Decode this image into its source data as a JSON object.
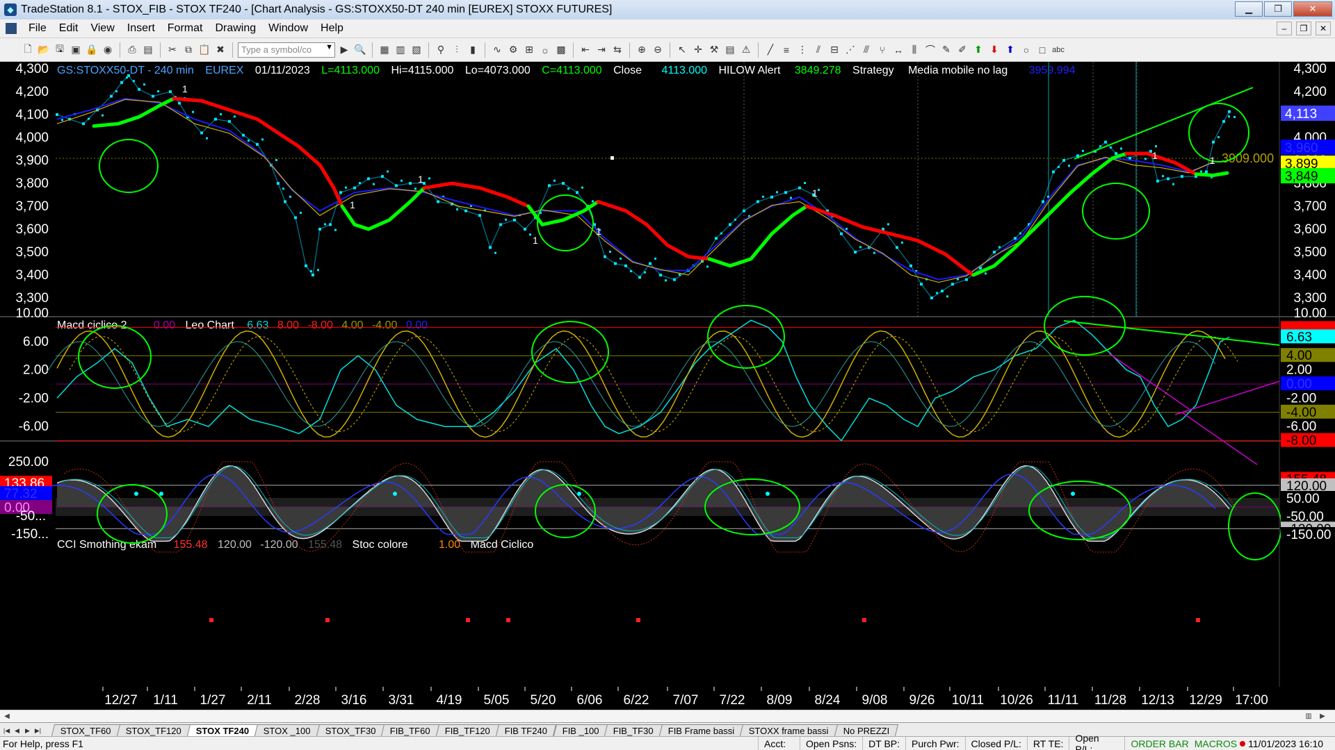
{
  "window": {
    "title": "TradeStation 8.1 - STOX_FIB - STOX TF240 - [Chart Analysis - GS:STOXX50-DT  240 min  [EUREX] STOXX FUTURES]"
  },
  "menu": [
    "File",
    "Edit",
    "View",
    "Insert",
    "Format",
    "Drawing",
    "Window",
    "Help"
  ],
  "toolbar": {
    "symbol_placeholder": "Type a symbol/co"
  },
  "price_panel": {
    "header": {
      "symbol": "GS:STOXX50-DT - 240 min",
      "exchange": "EUREX",
      "date": "01/11/2023",
      "last": "L=4113.000",
      "high": "Hi=4115.000",
      "low": "Lo=4073.000",
      "close_eq": "C=4113.000",
      "close_label": "Close",
      "close_val": "4113.000",
      "hilow_label": "HILOW Alert",
      "hilow_val": "3849.278",
      "strategy": "Strategy",
      "media_label": "Media mobile no lag",
      "media_val": "3959.994"
    },
    "y_ticks": [
      "4,300",
      "4,200",
      "4,100",
      "4,000",
      "3,900",
      "3,800",
      "3,700",
      "3,600",
      "3,500",
      "3,400",
      "3,300"
    ],
    "y_top_partial": "4,300",
    "price_label_level": "3909.000",
    "value_boxes": [
      {
        "text": "4,113",
        "bg": "#4040ff",
        "fg": "#ffffff"
      },
      {
        "text": "3,960",
        "bg": "#0000ff",
        "fg": "#3030ff"
      },
      {
        "text": "3,899",
        "bg": "#ffff00",
        "fg": "#000000"
      },
      {
        "text": "3,849",
        "bg": "#00ff00",
        "fg": "#000000"
      }
    ]
  },
  "macd_panel": {
    "header": {
      "name": "Macd ciclico 2",
      "v1": "0.00",
      "name2": "Leo Chart",
      "v2": "6.63",
      "v3": "8.00",
      "v4": "-8.00",
      "v5": "4.00",
      "v6": "-4.00",
      "v7": "0.00"
    },
    "y_ticks": [
      "10.00",
      "6.00",
      "2.00",
      "-2.00",
      "-6.00"
    ],
    "value_boxes": [
      {
        "text": "8.00",
        "bg": "#ff0000",
        "fg": "#ff0000"
      },
      {
        "text": "6.63",
        "bg": "#00ffff",
        "fg": "#000000"
      },
      {
        "text": "4.00",
        "bg": "#808000",
        "fg": "#000000"
      },
      {
        "text": "2.00",
        "bg": "#000000",
        "fg": "#ffffff"
      },
      {
        "text": "0.00",
        "bg": "#0000ff",
        "fg": "#3030ff"
      },
      {
        "text": "-2.00",
        "bg": "#000000",
        "fg": "#ffffff"
      },
      {
        "text": "-4.00",
        "bg": "#808000",
        "fg": "#000000"
      },
      {
        "text": "-6.00",
        "bg": "#000000",
        "fg": "#ffffff"
      },
      {
        "text": "-8.00",
        "bg": "#ff0000",
        "fg": "#000000"
      }
    ]
  },
  "cci_panel": {
    "header": {
      "name": "CCI Smothing ekam",
      "v1": "155.48",
      "v2": "120.00",
      "v3": "-120.00",
      "v4": "155.48",
      "name2": "Stoc colore",
      "v5": "1.00",
      "name3": "Macd Ciclico",
      "v6": "0.00"
    },
    "y_ticks": [
      "250.00",
      "50.00",
      "-50.00",
      "-150..."
    ],
    "right_boxes": [
      {
        "text": "155.48",
        "bg": "#ff0000",
        "fg": "#000000"
      },
      {
        "text": "120.00",
        "bg": "#c0c0c0",
        "fg": "#000000"
      },
      {
        "text": "50.00",
        "bg": "#000000",
        "fg": "#ffffff"
      },
      {
        "text": "-50.00",
        "bg": "#000000",
        "fg": "#ffffff"
      },
      {
        "text": "-120.00",
        "bg": "#c0c0c0",
        "fg": "#000000"
      },
      {
        "text": "-150.00",
        "bg": "#000000",
        "fg": "#ffffff"
      }
    ],
    "left_boxes": [
      {
        "text": "133.86",
        "bg": "#ff0000",
        "fg": "#ffffff"
      },
      {
        "text": "77.32",
        "bg": "#0000ff",
        "fg": "#3030ff"
      },
      {
        "text": "0.00",
        "bg": "#800080",
        "fg": "#ff80ff"
      }
    ]
  },
  "x_axis": [
    "12/27",
    "1/11",
    "1/27",
    "2/11",
    "2/28",
    "3/16",
    "3/31",
    "4/19",
    "5/05",
    "5/20",
    "6/06",
    "6/22",
    "7/07",
    "7/22",
    "8/09",
    "8/24",
    "9/08",
    "9/26",
    "10/11",
    "10/26",
    "11/11",
    "11/28",
    "12/13",
    "12/29",
    "17:00"
  ],
  "tabs": [
    "STOX_TF60",
    "STOX_TF120",
    "STOX TF240",
    "STOX _100",
    "STOX_TF30",
    "FIB_TF60",
    "FIB_TF120",
    "FIB TF240",
    "FIB _100",
    "FIB_TF30",
    "FIB Frame bassi",
    "STOXX frame bassi",
    "No PREZZI"
  ],
  "active_tab": "STOX TF240",
  "status": {
    "help": "For Help, press F1",
    "acct": "Acct:",
    "open_psns": "Open Psns:",
    "dt_bp": "DT BP:",
    "purch_pwr": "Purch Pwr:",
    "closed_pl": "Closed P/L:",
    "rt_te": "RT TE:",
    "open_pl": "Open P/L:",
    "order_bar": "ORDER BAR",
    "macros": "MACROS",
    "datetime": "11/01/2023 16:10"
  },
  "colors": {
    "price_dots": "#00e5ff",
    "trend_up": "#00ff00",
    "trend_down": "#ff0000",
    "ma_blue": "#1a1aff",
    "ma_yellow": "#e0c000",
    "annotation": "#00ff00"
  }
}
